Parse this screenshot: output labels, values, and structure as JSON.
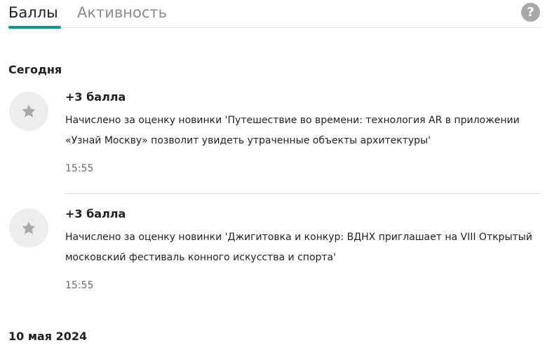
{
  "tabs": [
    {
      "label": "Баллы",
      "active": true
    },
    {
      "label": "Активность",
      "active": false
    }
  ],
  "help": {
    "icon": "help-icon",
    "glyph": "?"
  },
  "colors": {
    "accent": "#0b9b8a",
    "icon_bg": "#ededed",
    "star": "#a9a9a9"
  },
  "groups": [
    {
      "date": "Сегодня",
      "entries": [
        {
          "points": "+3 балла",
          "description": "Начислено за оценку новинки 'Путешествие во времени: технология AR в приложении «Узнай Москву» позволит увидеть утраченные объекты архитектуры'",
          "time": "15:55",
          "icon": "star-icon"
        },
        {
          "points": "+3 балла",
          "description": "Начислено за оценку новинки 'Джигитовка и конкур: ВДНХ приглашает на VIII Открытый московский фестиваль конного искусства и спорта'",
          "time": "15:55",
          "icon": "star-icon"
        }
      ]
    },
    {
      "date": "10 мая 2024",
      "entries": []
    }
  ]
}
